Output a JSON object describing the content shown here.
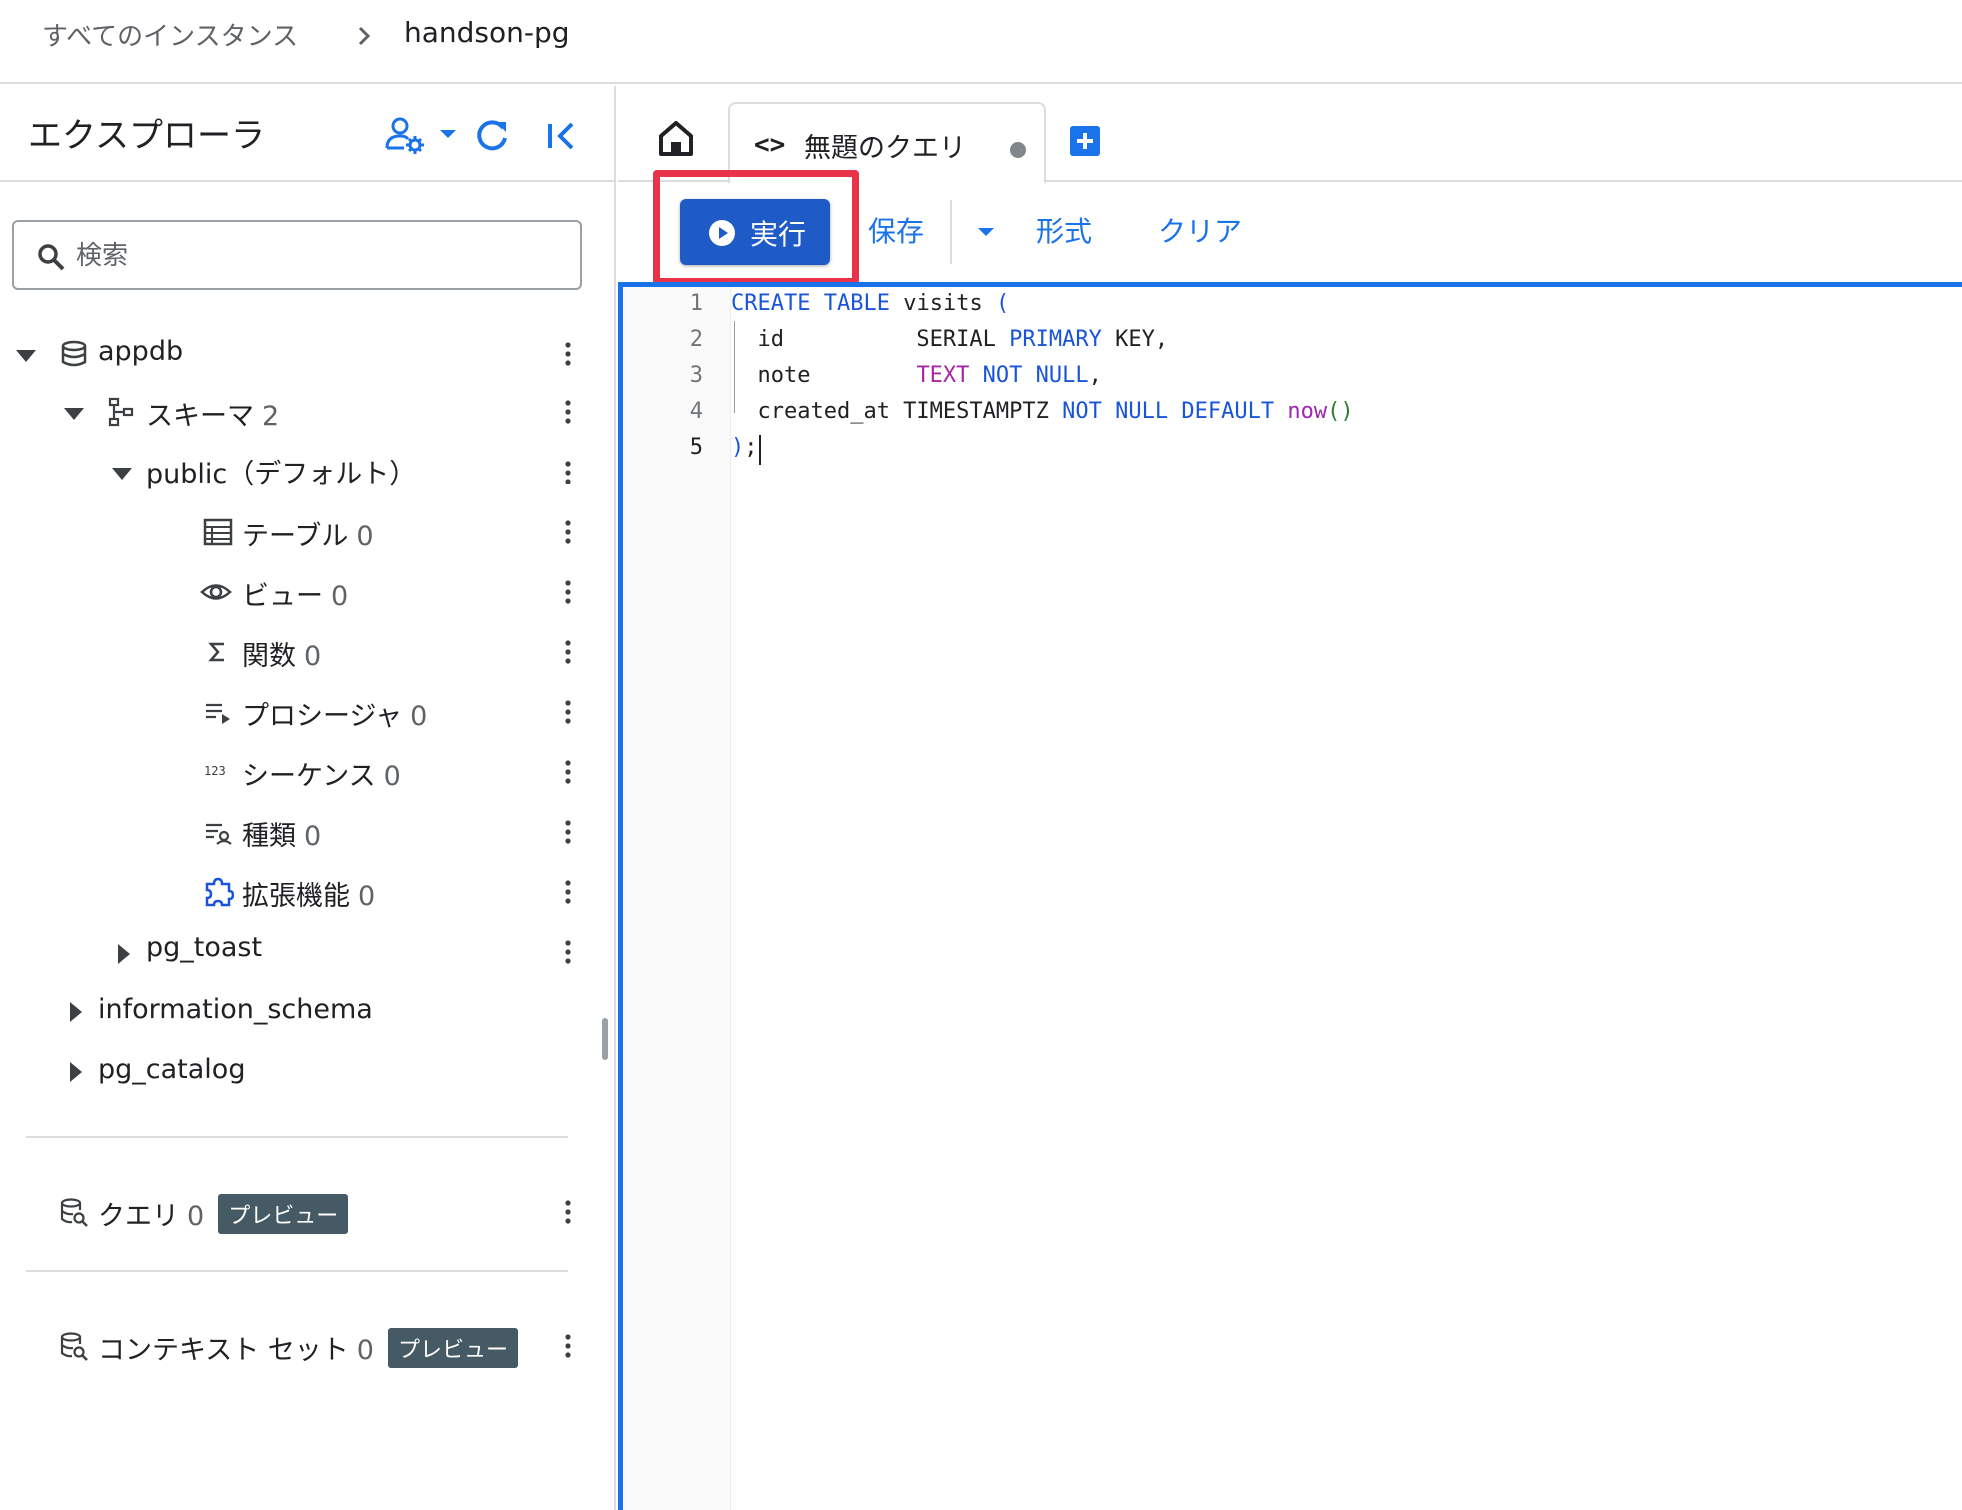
{
  "breadcrumb": {
    "root": "すべてのインスタンス",
    "current": "handson-pg"
  },
  "sidebar": {
    "title": "エクスプローラ",
    "search_placeholder": "検索",
    "tree": {
      "database": "appdb",
      "schemas_label": "スキーマ",
      "schemas_count": "2",
      "public_label": "public（デフォルト）",
      "items": [
        {
          "label": "テーブル",
          "count": "0",
          "icon": "table-icon"
        },
        {
          "label": "ビュー",
          "count": "0",
          "icon": "eye-icon"
        },
        {
          "label": "関数",
          "count": "0",
          "icon": "sigma-icon"
        },
        {
          "label": "プロシージャ",
          "count": "0",
          "icon": "procedure-icon"
        },
        {
          "label": "シーケンス",
          "count": "0",
          "icon": "sequence-icon"
        },
        {
          "label": "種類",
          "count": "0",
          "icon": "type-icon"
        },
        {
          "label": "拡張機能",
          "count": "0",
          "icon": "extension-icon"
        }
      ],
      "pg_toast": "pg_toast",
      "information_schema": "information_schema",
      "pg_catalog": "pg_catalog"
    },
    "queries": {
      "label": "クエリ",
      "count": "0",
      "badge": "プレビュー"
    },
    "context_sets": {
      "label": "コンテキスト セット",
      "count": "0",
      "badge": "プレビュー"
    }
  },
  "tabs": {
    "query_tab_title": "無題のクエリ",
    "code_glyph": "<>"
  },
  "toolbar": {
    "run": "実行",
    "save": "保存",
    "format": "形式",
    "clear": "クリア"
  },
  "editor": {
    "line_numbers": [
      "1",
      "2",
      "3",
      "4",
      "5"
    ],
    "lines": [
      "CREATE TABLE visits (",
      "  id          SERIAL PRIMARY KEY,",
      "  note        TEXT NOT NULL,",
      "  created_at TIMESTAMPTZ NOT NULL DEFAULT now()",
      ");"
    ]
  },
  "colors": {
    "accent": "#1a73e8",
    "run_button": "#1f5bc6",
    "highlight": "#e8334a",
    "badge": "#455a64"
  }
}
